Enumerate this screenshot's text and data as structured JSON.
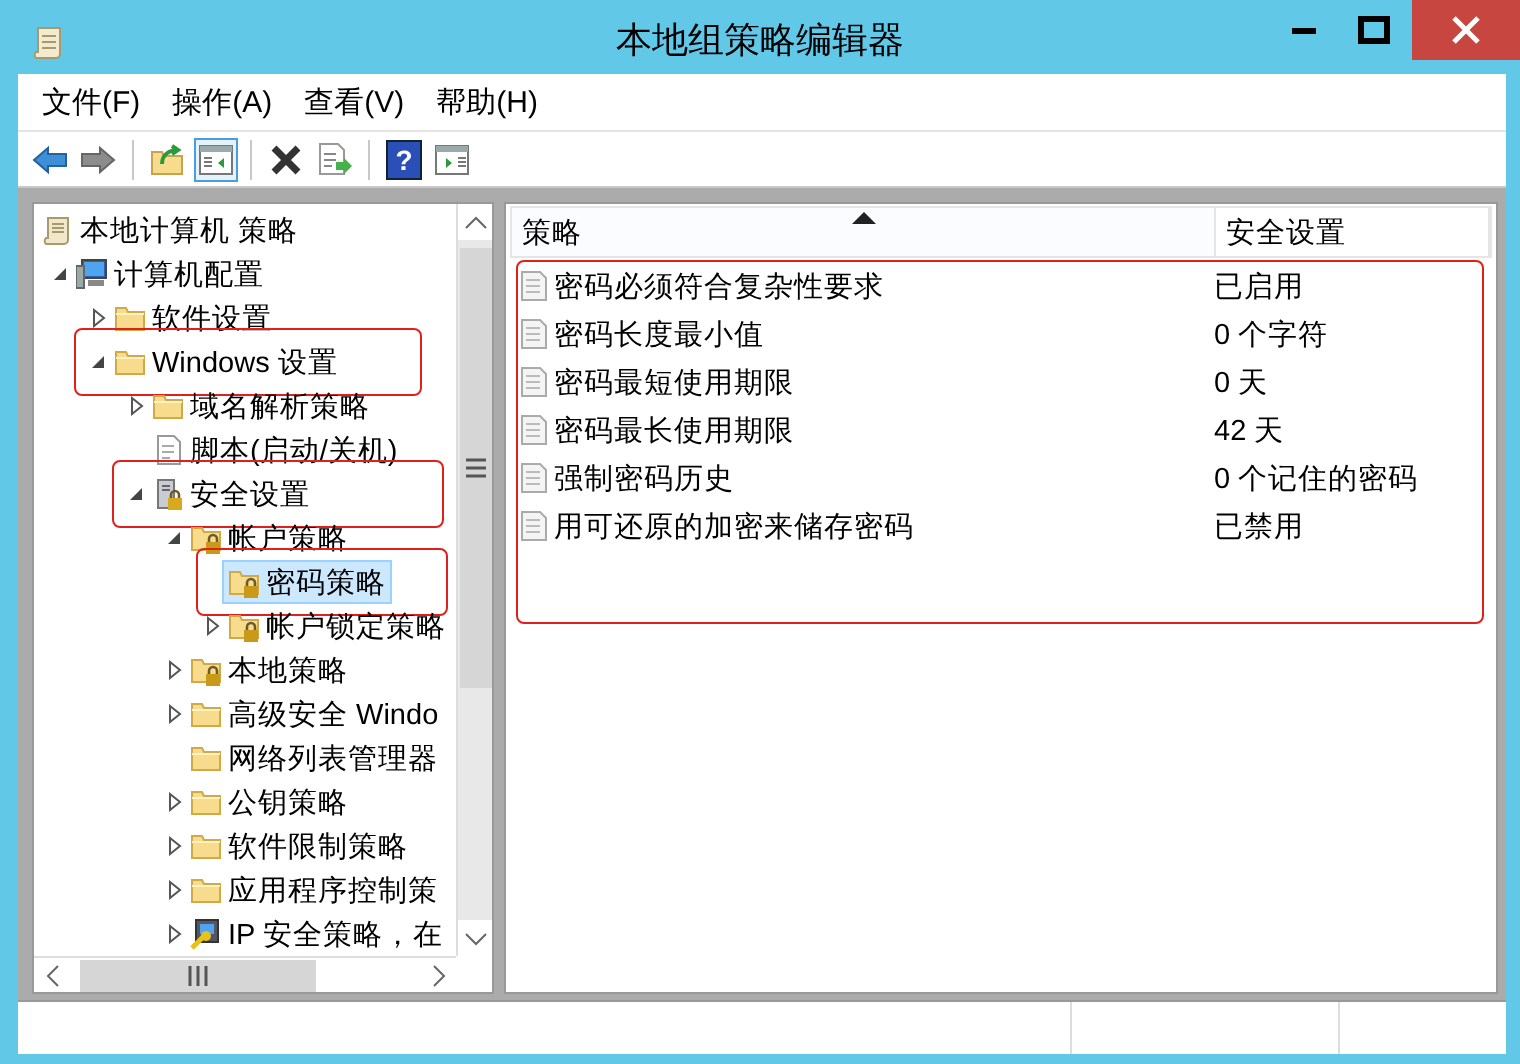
{
  "window": {
    "title": "本地组策略编辑器"
  },
  "menu": [
    {
      "label": "文件(F)"
    },
    {
      "label": "操作(A)"
    },
    {
      "label": "查看(V)"
    },
    {
      "label": "帮助(H)"
    }
  ],
  "toolbar": [
    {
      "kind": "back",
      "pressed": false
    },
    {
      "kind": "forward",
      "pressed": false
    },
    {
      "kind": "separator"
    },
    {
      "kind": "up",
      "pressed": false
    },
    {
      "kind": "tree-toggle",
      "pressed": true
    },
    {
      "kind": "separator"
    },
    {
      "kind": "delete",
      "pressed": false
    },
    {
      "kind": "export",
      "pressed": false
    },
    {
      "kind": "separator"
    },
    {
      "kind": "help",
      "pressed": false,
      "glyph": "?"
    },
    {
      "kind": "panel",
      "pressed": false
    }
  ],
  "tree": [
    {
      "label": "本地计算机 策略",
      "kind": "scroll",
      "expandable": false,
      "selected": false,
      "highlighted": false,
      "children": [
        {
          "label": "计算机配置",
          "kind": "computer",
          "expandable": true,
          "expanded": true,
          "selected": false,
          "highlighted": false,
          "children": [
            {
              "label": "软件设置",
              "kind": "folder",
              "expandable": true,
              "expanded": false,
              "selected": false,
              "highlighted": false
            },
            {
              "label": "Windows 设置",
              "kind": "folder",
              "expandable": true,
              "expanded": true,
              "selected": false,
              "highlighted": true,
              "children": [
                {
                  "label": "域名解析策略",
                  "kind": "folder",
                  "expandable": true,
                  "expanded": false,
                  "selected": false,
                  "highlighted": false
                },
                {
                  "label": "脚本(启动/关机)",
                  "kind": "script",
                  "expandable": false,
                  "selected": false,
                  "highlighted": false
                },
                {
                  "label": "安全设置",
                  "kind": "security",
                  "expandable": true,
                  "expanded": true,
                  "selected": false,
                  "highlighted": true,
                  "children": [
                    {
                      "label": "帐户策略",
                      "kind": "locked-folder",
                      "expandable": true,
                      "expanded": true,
                      "selected": false,
                      "highlighted": false,
                      "children": [
                        {
                          "label": "密码策略",
                          "kind": "locked-folder",
                          "expandable": false,
                          "selected": true,
                          "highlighted": true
                        },
                        {
                          "label": "帐户锁定策略",
                          "kind": "locked-folder",
                          "expandable": true,
                          "expanded": false,
                          "selected": false,
                          "highlighted": false
                        }
                      ]
                    },
                    {
                      "label": "本地策略",
                      "kind": "locked-folder",
                      "expandable": true,
                      "expanded": false,
                      "selected": false,
                      "highlighted": false
                    },
                    {
                      "label": "高级安全 Windo",
                      "kind": "folder",
                      "expandable": true,
                      "expanded": false,
                      "selected": false,
                      "highlighted": false
                    },
                    {
                      "label": "网络列表管理器",
                      "kind": "folder",
                      "expandable": false,
                      "selected": false,
                      "highlighted": false
                    },
                    {
                      "label": "公钥策略",
                      "kind": "folder",
                      "expandable": true,
                      "expanded": false,
                      "selected": false,
                      "highlighted": false
                    },
                    {
                      "label": "软件限制策略",
                      "kind": "folder",
                      "expandable": true,
                      "expanded": false,
                      "selected": false,
                      "highlighted": false
                    },
                    {
                      "label": "应用程序控制策",
                      "kind": "folder",
                      "expandable": true,
                      "expanded": false,
                      "selected": false,
                      "highlighted": false
                    },
                    {
                      "label": "IP 安全策略，在",
                      "kind": "ip-security",
                      "expandable": true,
                      "expanded": false,
                      "selected": false,
                      "highlighted": false
                    }
                  ]
                }
              ]
            }
          ]
        }
      ]
    }
  ],
  "table": {
    "columns": [
      {
        "label": "策略",
        "sorted": true
      },
      {
        "label": "安全设置",
        "sorted": false
      }
    ],
    "highlighted": true,
    "rows": [
      {
        "policy": "密码必须符合复杂性要求",
        "setting": "已启用"
      },
      {
        "policy": "密码长度最小值",
        "setting": "0 个字符"
      },
      {
        "policy": "密码最短使用期限",
        "setting": "0 天"
      },
      {
        "policy": "密码最长使用期限",
        "setting": "42 天"
      },
      {
        "policy": "强制密码历史",
        "setting": "0 个记住的密码"
      },
      {
        "policy": "用可还原的加密来储存密码",
        "setting": "已禁用"
      }
    ]
  }
}
